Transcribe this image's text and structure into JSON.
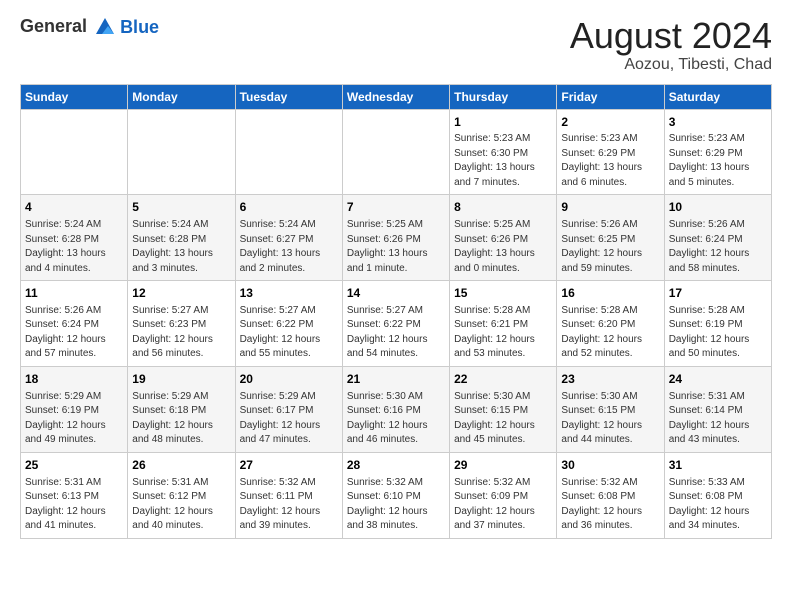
{
  "header": {
    "logo_line1": "General",
    "logo_line2": "Blue",
    "title": "August 2024",
    "location": "Aozou, Tibesti, Chad"
  },
  "days_of_week": [
    "Sunday",
    "Monday",
    "Tuesday",
    "Wednesday",
    "Thursday",
    "Friday",
    "Saturday"
  ],
  "weeks": [
    [
      {
        "day": "",
        "info": ""
      },
      {
        "day": "",
        "info": ""
      },
      {
        "day": "",
        "info": ""
      },
      {
        "day": "",
        "info": ""
      },
      {
        "day": "1",
        "info": "Sunrise: 5:23 AM\nSunset: 6:30 PM\nDaylight: 13 hours and 7 minutes."
      },
      {
        "day": "2",
        "info": "Sunrise: 5:23 AM\nSunset: 6:29 PM\nDaylight: 13 hours and 6 minutes."
      },
      {
        "day": "3",
        "info": "Sunrise: 5:23 AM\nSunset: 6:29 PM\nDaylight: 13 hours and 5 minutes."
      }
    ],
    [
      {
        "day": "4",
        "info": "Sunrise: 5:24 AM\nSunset: 6:28 PM\nDaylight: 13 hours and 4 minutes."
      },
      {
        "day": "5",
        "info": "Sunrise: 5:24 AM\nSunset: 6:28 PM\nDaylight: 13 hours and 3 minutes."
      },
      {
        "day": "6",
        "info": "Sunrise: 5:24 AM\nSunset: 6:27 PM\nDaylight: 13 hours and 2 minutes."
      },
      {
        "day": "7",
        "info": "Sunrise: 5:25 AM\nSunset: 6:26 PM\nDaylight: 13 hours and 1 minute."
      },
      {
        "day": "8",
        "info": "Sunrise: 5:25 AM\nSunset: 6:26 PM\nDaylight: 13 hours and 0 minutes."
      },
      {
        "day": "9",
        "info": "Sunrise: 5:26 AM\nSunset: 6:25 PM\nDaylight: 12 hours and 59 minutes."
      },
      {
        "day": "10",
        "info": "Sunrise: 5:26 AM\nSunset: 6:24 PM\nDaylight: 12 hours and 58 minutes."
      }
    ],
    [
      {
        "day": "11",
        "info": "Sunrise: 5:26 AM\nSunset: 6:24 PM\nDaylight: 12 hours and 57 minutes."
      },
      {
        "day": "12",
        "info": "Sunrise: 5:27 AM\nSunset: 6:23 PM\nDaylight: 12 hours and 56 minutes."
      },
      {
        "day": "13",
        "info": "Sunrise: 5:27 AM\nSunset: 6:22 PM\nDaylight: 12 hours and 55 minutes."
      },
      {
        "day": "14",
        "info": "Sunrise: 5:27 AM\nSunset: 6:22 PM\nDaylight: 12 hours and 54 minutes."
      },
      {
        "day": "15",
        "info": "Sunrise: 5:28 AM\nSunset: 6:21 PM\nDaylight: 12 hours and 53 minutes."
      },
      {
        "day": "16",
        "info": "Sunrise: 5:28 AM\nSunset: 6:20 PM\nDaylight: 12 hours and 52 minutes."
      },
      {
        "day": "17",
        "info": "Sunrise: 5:28 AM\nSunset: 6:19 PM\nDaylight: 12 hours and 50 minutes."
      }
    ],
    [
      {
        "day": "18",
        "info": "Sunrise: 5:29 AM\nSunset: 6:19 PM\nDaylight: 12 hours and 49 minutes."
      },
      {
        "day": "19",
        "info": "Sunrise: 5:29 AM\nSunset: 6:18 PM\nDaylight: 12 hours and 48 minutes."
      },
      {
        "day": "20",
        "info": "Sunrise: 5:29 AM\nSunset: 6:17 PM\nDaylight: 12 hours and 47 minutes."
      },
      {
        "day": "21",
        "info": "Sunrise: 5:30 AM\nSunset: 6:16 PM\nDaylight: 12 hours and 46 minutes."
      },
      {
        "day": "22",
        "info": "Sunrise: 5:30 AM\nSunset: 6:15 PM\nDaylight: 12 hours and 45 minutes."
      },
      {
        "day": "23",
        "info": "Sunrise: 5:30 AM\nSunset: 6:15 PM\nDaylight: 12 hours and 44 minutes."
      },
      {
        "day": "24",
        "info": "Sunrise: 5:31 AM\nSunset: 6:14 PM\nDaylight: 12 hours and 43 minutes."
      }
    ],
    [
      {
        "day": "25",
        "info": "Sunrise: 5:31 AM\nSunset: 6:13 PM\nDaylight: 12 hours and 41 minutes."
      },
      {
        "day": "26",
        "info": "Sunrise: 5:31 AM\nSunset: 6:12 PM\nDaylight: 12 hours and 40 minutes."
      },
      {
        "day": "27",
        "info": "Sunrise: 5:32 AM\nSunset: 6:11 PM\nDaylight: 12 hours and 39 minutes."
      },
      {
        "day": "28",
        "info": "Sunrise: 5:32 AM\nSunset: 6:10 PM\nDaylight: 12 hours and 38 minutes."
      },
      {
        "day": "29",
        "info": "Sunrise: 5:32 AM\nSunset: 6:09 PM\nDaylight: 12 hours and 37 minutes."
      },
      {
        "day": "30",
        "info": "Sunrise: 5:32 AM\nSunset: 6:08 PM\nDaylight: 12 hours and 36 minutes."
      },
      {
        "day": "31",
        "info": "Sunrise: 5:33 AM\nSunset: 6:08 PM\nDaylight: 12 hours and 34 minutes."
      }
    ]
  ]
}
